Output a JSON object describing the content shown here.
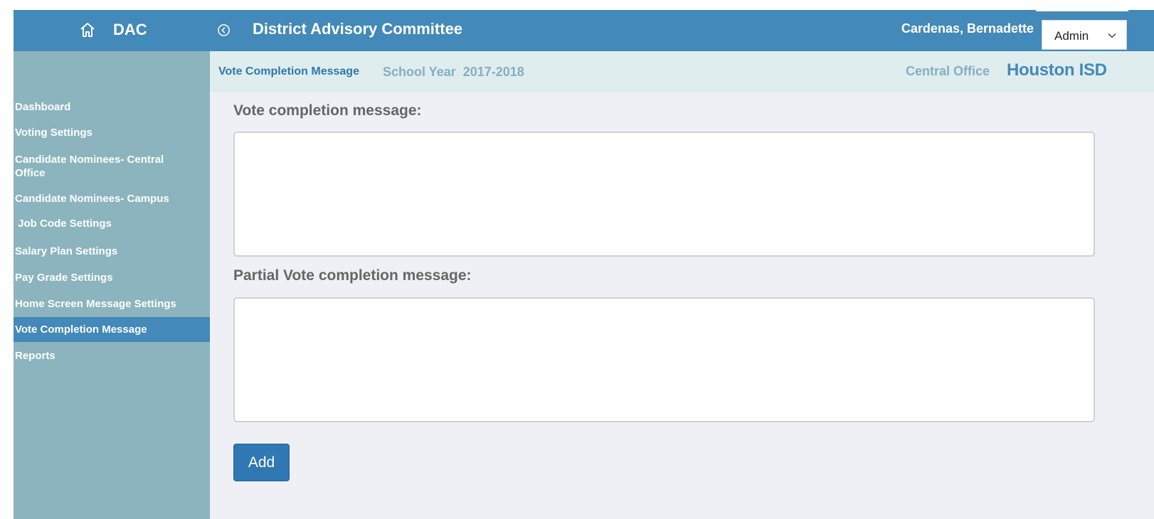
{
  "header": {
    "brand": "DAC",
    "title": "District Advisory Committee",
    "user_name": "Cardenas, Bernadette",
    "role_selected": "Admin"
  },
  "sidebar": {
    "items": [
      {
        "label": "Dashboard"
      },
      {
        "label": "Voting Settings"
      },
      {
        "label": "Candidate Nominees- Central Office"
      },
      {
        "label": "Candidate Nominees- Campus"
      },
      {
        "label": " Job Code Settings"
      },
      {
        "label": "Salary Plan Settings"
      },
      {
        "label": "Pay Grade Settings"
      },
      {
        "label": "Home Screen Message Settings"
      },
      {
        "label": "Vote Completion Message"
      },
      {
        "label": "Reports"
      }
    ],
    "active_index": 8
  },
  "subheader": {
    "breadcrumb": "Vote Completion Message",
    "school_year": "School Year  2017-2018",
    "office": "Central Office",
    "organization": "Houston ISD"
  },
  "form": {
    "vote_label": "Vote completion message:",
    "vote_value": "",
    "partial_label": "Partial Vote completion message:",
    "partial_value": "",
    "add_label": "Add"
  },
  "colors": {
    "header": "#4389b9",
    "sidebar": "#8bb4be",
    "subheader": "#dfedee",
    "content": "#eff0f5",
    "button": "#3078b4"
  }
}
